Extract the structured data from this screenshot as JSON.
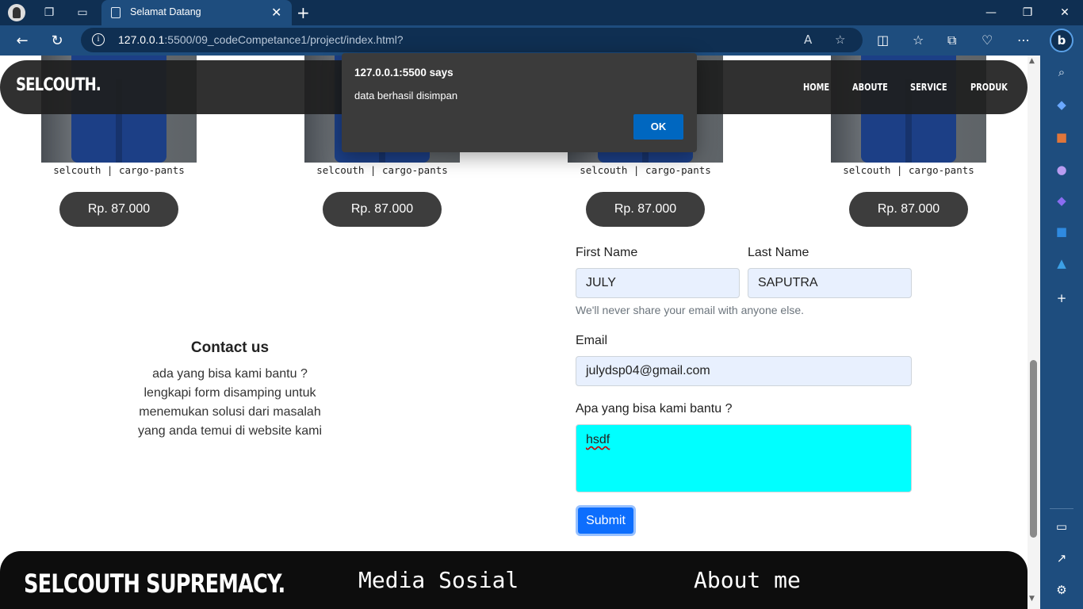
{
  "browser": {
    "tab_title": "Selamat Datang",
    "url_host": "127.0.0.1",
    "url_rest": ":5500/09_codeCompetance1/project/index.html?",
    "edge_bing_label": "b"
  },
  "navbar": {
    "brand": "SELCOUTH.",
    "links": [
      "HOME",
      "ABOUTE",
      "SERVICE",
      "PRODUK"
    ]
  },
  "products": [
    {
      "name": "selcouth | cargo-pants",
      "price": "Rp. 87.000"
    },
    {
      "name": "selcouth | cargo-pants",
      "price": "Rp. 87.000"
    },
    {
      "name": "selcouth | cargo-pants",
      "price": "Rp. 87.000"
    },
    {
      "name": "selcouth | cargo-pants",
      "price": "Rp. 87.000"
    }
  ],
  "contact": {
    "title": "Contact us",
    "lines": [
      "ada yang bisa kami bantu ?",
      "lengkapi form disamping untuk",
      "menemukan solusi dari masalah",
      "yang anda temui di website kami"
    ]
  },
  "form": {
    "first_name_label": "First Name",
    "first_name_value": "JULY",
    "last_name_label": "Last Name",
    "last_name_value": "SAPUTRA",
    "help_text": "We'll never share your email with anyone else.",
    "email_label": "Email",
    "email_value": "julydsp04@gmail.com",
    "message_label": "Apa yang bisa kami bantu ?",
    "message_value": "hsdf",
    "submit_label": "Submit",
    "message_bg": "#00ffff"
  },
  "footer": {
    "brand": "SELCOUTH SUPREMACY.",
    "col2": "Media Sosial",
    "col3": "About me"
  },
  "alert": {
    "origin": "127.0.0.1:5500 says",
    "message": "data berhasil disimpan",
    "ok_label": "OK"
  }
}
